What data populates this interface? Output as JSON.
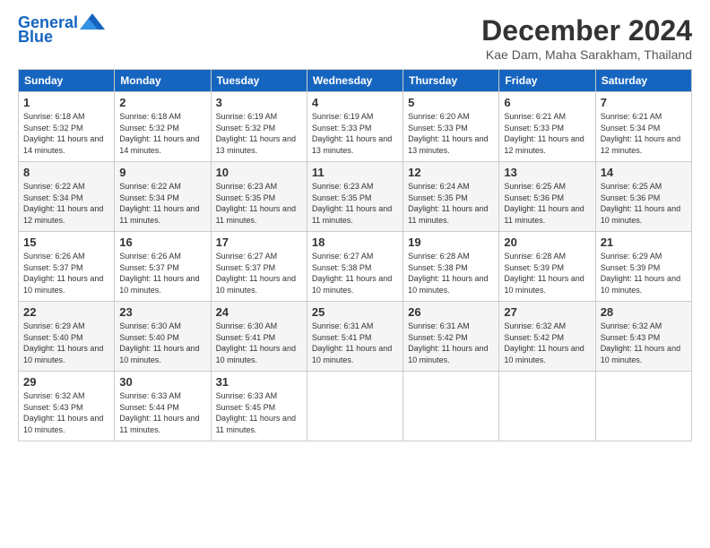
{
  "logo": {
    "line1": "General",
    "line2": "Blue"
  },
  "title": "December 2024",
  "location": "Kae Dam, Maha Sarakham, Thailand",
  "headers": [
    "Sunday",
    "Monday",
    "Tuesday",
    "Wednesday",
    "Thursday",
    "Friday",
    "Saturday"
  ],
  "weeks": [
    [
      {
        "day": "1",
        "sunrise": "6:18 AM",
        "sunset": "5:32 PM",
        "daylight": "11 hours and 14 minutes."
      },
      {
        "day": "2",
        "sunrise": "6:18 AM",
        "sunset": "5:32 PM",
        "daylight": "11 hours and 14 minutes."
      },
      {
        "day": "3",
        "sunrise": "6:19 AM",
        "sunset": "5:32 PM",
        "daylight": "11 hours and 13 minutes."
      },
      {
        "day": "4",
        "sunrise": "6:19 AM",
        "sunset": "5:33 PM",
        "daylight": "11 hours and 13 minutes."
      },
      {
        "day": "5",
        "sunrise": "6:20 AM",
        "sunset": "5:33 PM",
        "daylight": "11 hours and 13 minutes."
      },
      {
        "day": "6",
        "sunrise": "6:21 AM",
        "sunset": "5:33 PM",
        "daylight": "11 hours and 12 minutes."
      },
      {
        "day": "7",
        "sunrise": "6:21 AM",
        "sunset": "5:34 PM",
        "daylight": "11 hours and 12 minutes."
      }
    ],
    [
      {
        "day": "8",
        "sunrise": "6:22 AM",
        "sunset": "5:34 PM",
        "daylight": "11 hours and 12 minutes."
      },
      {
        "day": "9",
        "sunrise": "6:22 AM",
        "sunset": "5:34 PM",
        "daylight": "11 hours and 11 minutes."
      },
      {
        "day": "10",
        "sunrise": "6:23 AM",
        "sunset": "5:35 PM",
        "daylight": "11 hours and 11 minutes."
      },
      {
        "day": "11",
        "sunrise": "6:23 AM",
        "sunset": "5:35 PM",
        "daylight": "11 hours and 11 minutes."
      },
      {
        "day": "12",
        "sunrise": "6:24 AM",
        "sunset": "5:35 PM",
        "daylight": "11 hours and 11 minutes."
      },
      {
        "day": "13",
        "sunrise": "6:25 AM",
        "sunset": "5:36 PM",
        "daylight": "11 hours and 11 minutes."
      },
      {
        "day": "14",
        "sunrise": "6:25 AM",
        "sunset": "5:36 PM",
        "daylight": "11 hours and 10 minutes."
      }
    ],
    [
      {
        "day": "15",
        "sunrise": "6:26 AM",
        "sunset": "5:37 PM",
        "daylight": "11 hours and 10 minutes."
      },
      {
        "day": "16",
        "sunrise": "6:26 AM",
        "sunset": "5:37 PM",
        "daylight": "11 hours and 10 minutes."
      },
      {
        "day": "17",
        "sunrise": "6:27 AM",
        "sunset": "5:37 PM",
        "daylight": "11 hours and 10 minutes."
      },
      {
        "day": "18",
        "sunrise": "6:27 AM",
        "sunset": "5:38 PM",
        "daylight": "11 hours and 10 minutes."
      },
      {
        "day": "19",
        "sunrise": "6:28 AM",
        "sunset": "5:38 PM",
        "daylight": "11 hours and 10 minutes."
      },
      {
        "day": "20",
        "sunrise": "6:28 AM",
        "sunset": "5:39 PM",
        "daylight": "11 hours and 10 minutes."
      },
      {
        "day": "21",
        "sunrise": "6:29 AM",
        "sunset": "5:39 PM",
        "daylight": "11 hours and 10 minutes."
      }
    ],
    [
      {
        "day": "22",
        "sunrise": "6:29 AM",
        "sunset": "5:40 PM",
        "daylight": "11 hours and 10 minutes."
      },
      {
        "day": "23",
        "sunrise": "6:30 AM",
        "sunset": "5:40 PM",
        "daylight": "11 hours and 10 minutes."
      },
      {
        "day": "24",
        "sunrise": "6:30 AM",
        "sunset": "5:41 PM",
        "daylight": "11 hours and 10 minutes."
      },
      {
        "day": "25",
        "sunrise": "6:31 AM",
        "sunset": "5:41 PM",
        "daylight": "11 hours and 10 minutes."
      },
      {
        "day": "26",
        "sunrise": "6:31 AM",
        "sunset": "5:42 PM",
        "daylight": "11 hours and 10 minutes."
      },
      {
        "day": "27",
        "sunrise": "6:32 AM",
        "sunset": "5:42 PM",
        "daylight": "11 hours and 10 minutes."
      },
      {
        "day": "28",
        "sunrise": "6:32 AM",
        "sunset": "5:43 PM",
        "daylight": "11 hours and 10 minutes."
      }
    ],
    [
      {
        "day": "29",
        "sunrise": "6:32 AM",
        "sunset": "5:43 PM",
        "daylight": "11 hours and 10 minutes."
      },
      {
        "day": "30",
        "sunrise": "6:33 AM",
        "sunset": "5:44 PM",
        "daylight": "11 hours and 11 minutes."
      },
      {
        "day": "31",
        "sunrise": "6:33 AM",
        "sunset": "5:45 PM",
        "daylight": "11 hours and 11 minutes."
      },
      null,
      null,
      null,
      null
    ]
  ]
}
